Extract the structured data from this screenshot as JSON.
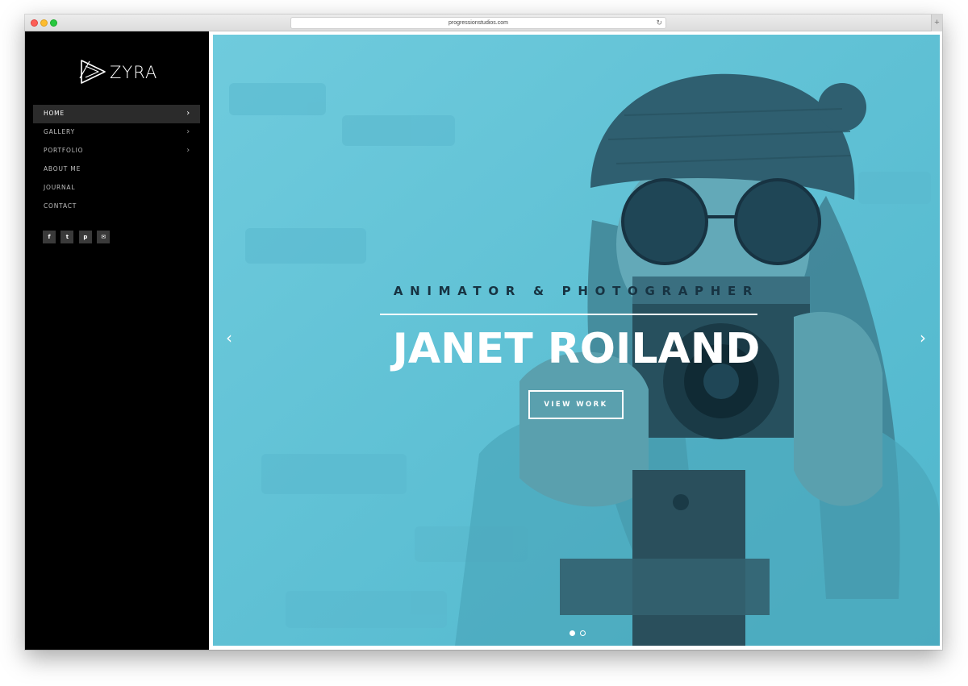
{
  "browser": {
    "url": "progressionstudios.com",
    "reload_icon": "reload-icon",
    "newtab_label": "+"
  },
  "sidebar": {
    "logo_text": "ZYRA",
    "nav": [
      {
        "label": "HOME",
        "active": true,
        "has_submenu": true
      },
      {
        "label": "GALLERY",
        "active": false,
        "has_submenu": true
      },
      {
        "label": "PORTFOLIO",
        "active": false,
        "has_submenu": true
      },
      {
        "label": "ABOUT ME",
        "active": false,
        "has_submenu": false
      },
      {
        "label": "JOURNAL",
        "active": false,
        "has_submenu": false
      },
      {
        "label": "CONTACT",
        "active": false,
        "has_submenu": false
      }
    ],
    "social": [
      {
        "icon": "facebook-icon",
        "glyph": "f"
      },
      {
        "icon": "twitter-icon",
        "glyph": "t"
      },
      {
        "icon": "pinterest-icon",
        "glyph": "p"
      },
      {
        "icon": "mail-icon",
        "glyph": "✉"
      }
    ]
  },
  "hero": {
    "tagline": "ANIMATOR & PHOTOGRAPHER",
    "name": "JANET ROILAND",
    "cta_label": "VIEW WORK",
    "prev_icon": "‹",
    "next_icon": "›",
    "slide_count": 2,
    "active_slide": 1,
    "overlay_color": "#5bc2d7"
  },
  "colors": {
    "sidebar_bg": "#000000",
    "nav_active_bg": "#2b2b2b",
    "accent": "#5bc2d7",
    "tagline": "#173342"
  }
}
